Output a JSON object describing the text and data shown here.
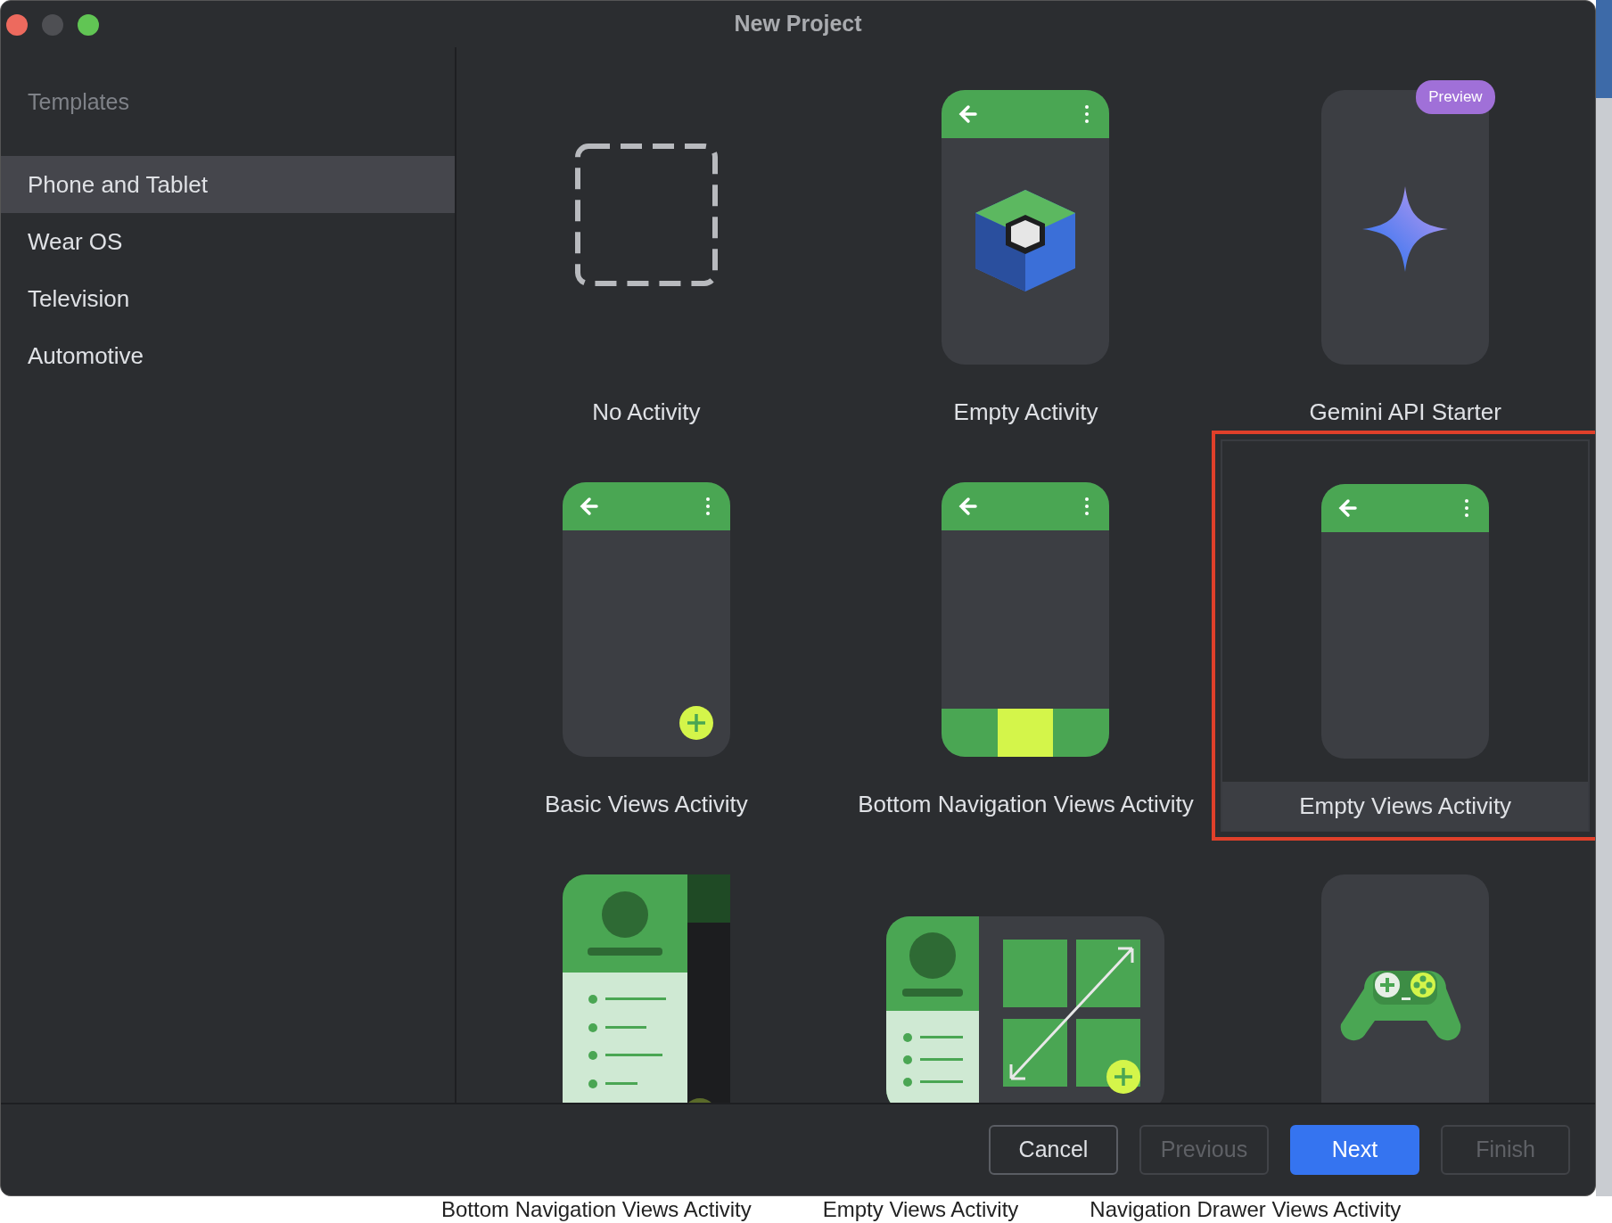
{
  "window": {
    "title": "New Project"
  },
  "sidebar": {
    "heading": "Templates",
    "items": [
      {
        "label": "Phone and Tablet",
        "selected": true
      },
      {
        "label": "Wear OS",
        "selected": false
      },
      {
        "label": "Television",
        "selected": false
      },
      {
        "label": "Automotive",
        "selected": false
      }
    ]
  },
  "templates": [
    {
      "kind": "blank",
      "label": "No Activity",
      "selected": false
    },
    {
      "kind": "empty",
      "label": "Empty Activity",
      "selected": false
    },
    {
      "kind": "gemini",
      "label": "Gemini API Starter",
      "badge": "Preview",
      "selected": false
    },
    {
      "kind": "basic",
      "label": "Basic Views Activity",
      "selected": false
    },
    {
      "kind": "bottom_nav",
      "label": "Bottom Navigation Views Activity",
      "selected": false
    },
    {
      "kind": "empty_views",
      "label": "Empty Views Activity",
      "selected": true,
      "highlighted": true
    },
    {
      "kind": "nav_drawer",
      "selected": false
    },
    {
      "kind": "responsive",
      "selected": false
    },
    {
      "kind": "game",
      "selected": false
    }
  ],
  "buttons": [
    {
      "label": "Cancel",
      "kind": "default",
      "disabled": false
    },
    {
      "label": "Previous",
      "kind": "default",
      "disabled": true
    },
    {
      "label": "Next",
      "kind": "primary",
      "disabled": false
    },
    {
      "label": "Finish",
      "kind": "default",
      "disabled": true
    }
  ],
  "background_labels": [
    "Bottom Navigation Views Activity",
    "Empty Views Activity",
    "Navigation Drawer Views Activity"
  ]
}
